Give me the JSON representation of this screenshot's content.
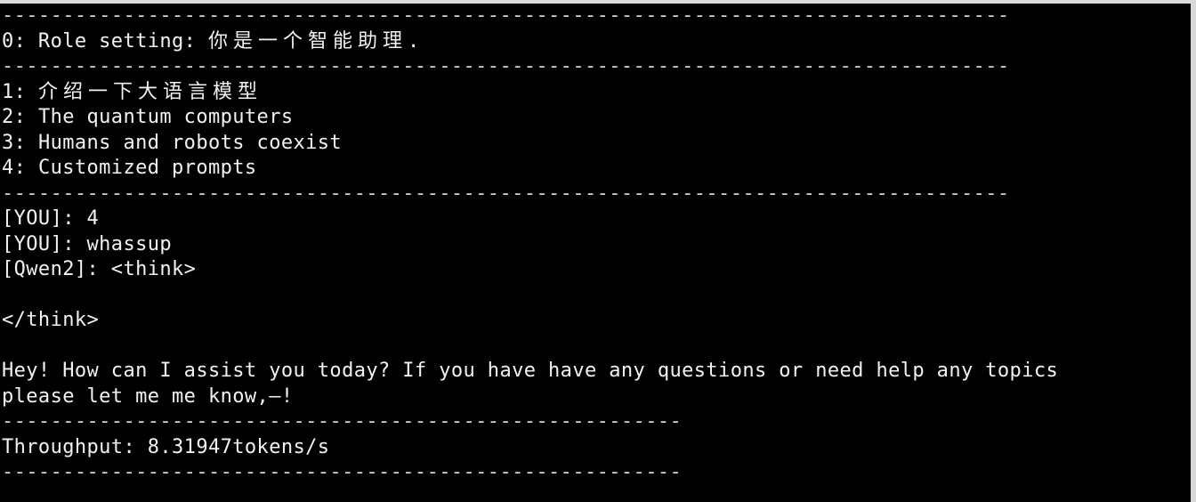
{
  "terminal": {
    "separator_long": "-----------------------------------------------------------------------------------",
    "separator_short": "--------------------------------------------------------",
    "role": {
      "prefix": "0: Role setting: ",
      "text": "你是一个智能助理."
    },
    "menu": [
      {
        "prefix": "1: ",
        "label": "介绍一下大语言模型"
      },
      {
        "prefix": "2: ",
        "label": "The quantum computers"
      },
      {
        "prefix": "3: ",
        "label": "Humans and robots coexist"
      },
      {
        "prefix": "4: ",
        "label": "Customized prompts"
      }
    ],
    "conversation": {
      "you_choice": "[YOU]: 4",
      "you_message": "[YOU]: whassup",
      "model_prefix": "[Qwen2]: <think>",
      "think_close": "</think>",
      "reply_line1": "Hey! How can I assist you today? If you have have any questions or need help any topics",
      "reply_line2": "please let me me know,—!"
    },
    "throughput": "Throughput: 8.31947tokens/s"
  }
}
